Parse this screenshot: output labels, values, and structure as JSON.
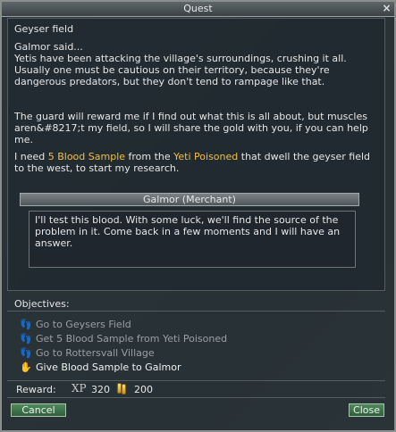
{
  "window": {
    "title": "Quest",
    "close_glyph": "×"
  },
  "quest": {
    "name": "Geyser field",
    "speaker_line": "Galmor said...",
    "paragraphs": [
      "Yetis have been attacking the village's surroundings, crushing it all. Usually one must be cautious on their territory, because they're dangerous predators, but they don't tend to rampage like that.",
      "The guard will reward me if I find out what this is all about, but muscles aren&#8217;t my field, so I will share the gold with you, if you can help me."
    ],
    "request": {
      "before": "I need ",
      "item": "5 Blood Sample",
      "middle": " from the ",
      "creature": "Yeti Poisoned",
      "after": " that dwell the geyser field to the west, to start my research."
    },
    "highlight_color": "#f0c040"
  },
  "merchant": {
    "title": "Galmor (Merchant)",
    "text": "I'll test this blood. With some luck, we'll find the source of the problem in it. Come back in a few moments and I will have an answer."
  },
  "objectives": {
    "label": "Objectives:",
    "items": [
      {
        "text": "Go to Geysers Field",
        "state": "done",
        "icon": "footsteps-icon"
      },
      {
        "text": "Get 5 Blood Sample from Yeti Poisoned",
        "state": "done",
        "icon": "footsteps-icon"
      },
      {
        "text": "Go to Rottersvall Village",
        "state": "done",
        "icon": "footsteps-icon"
      },
      {
        "text": "Give Blood Sample to Galmor",
        "state": "active",
        "icon": "hand-icon"
      }
    ]
  },
  "reward": {
    "label": "Reward:",
    "xp_label": "XP",
    "xp": "320",
    "gold": "200"
  },
  "buttons": {
    "cancel": "Cancel",
    "close": "Close"
  }
}
